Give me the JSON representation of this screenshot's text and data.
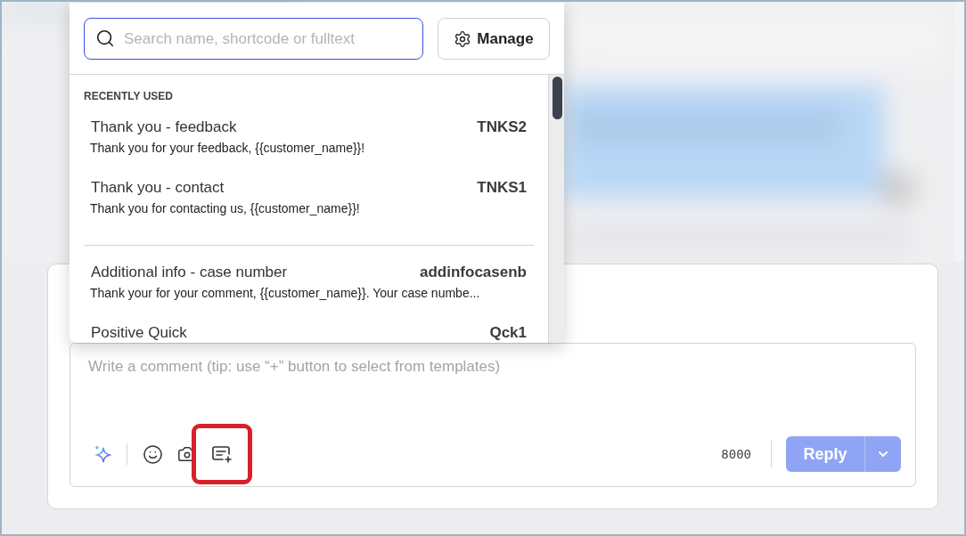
{
  "search": {
    "placeholder": "Search name, shortcode or fulltext"
  },
  "manage_button": {
    "label": "Manage"
  },
  "template_groups": [
    {
      "heading": "RECENTLY USED",
      "items": [
        {
          "title": "Thank you - feedback",
          "shortcode": "TNKS2",
          "text": "Thank you for your feedback, {{customer_name}}!"
        },
        {
          "title": "Thank you - contact",
          "shortcode": "TNKS1",
          "text": "Thank you for contacting us, {{customer_name}}!"
        }
      ]
    },
    {
      "items": [
        {
          "title": "Additional info - case number",
          "shortcode": "addinfocasenb",
          "text": "Thank your for your comment, {{customer_name}}. Your case numbe..."
        },
        {
          "title": "Positive Quick",
          "shortcode": "Qck1"
        }
      ]
    }
  ],
  "composer": {
    "placeholder": "Write a comment (tip: use “+” button to select from templates)",
    "tools": [
      {
        "kind": "ai",
        "highlighted": false
      },
      {
        "kind": "emoji",
        "highlighted": false
      },
      {
        "kind": "camera",
        "highlighted": false
      },
      {
        "kind": "template",
        "highlighted": true
      }
    ],
    "char_count": "8000",
    "reply_button": {
      "label": "Reply",
      "disabled": true
    }
  }
}
